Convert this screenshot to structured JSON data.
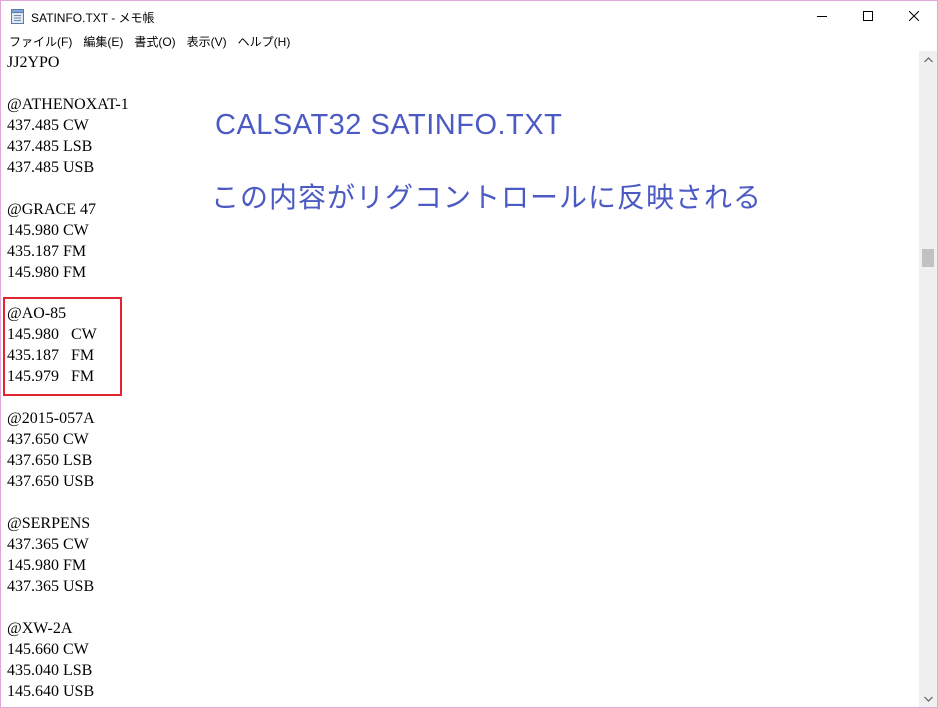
{
  "window": {
    "title": "SATINFO.TXT - メモ帳",
    "icon": "notepad-icon"
  },
  "menu": [
    {
      "label": "ファイル(F)"
    },
    {
      "label": "編集(E)"
    },
    {
      "label": "書式(O)"
    },
    {
      "label": "表示(V)"
    },
    {
      "label": "ヘルプ(H)"
    }
  ],
  "editor": {
    "lines": [
      "JJ2YPO",
      "",
      "@ATHENOXAT-1",
      "437.485 CW",
      "437.485 LSB",
      "437.485 USB",
      "",
      "@GRACE 47",
      "145.980 CW",
      "435.187 FM",
      "145.980 FM",
      "",
      "@AO-85",
      "145.980   CW",
      "435.187   FM",
      "145.979   FM",
      "",
      "@2015-057A",
      "437.650 CW",
      "437.650 LSB",
      "437.650 USB",
      "",
      "@SERPENS",
      "437.365 CW",
      "145.980 FM",
      "437.365 USB",
      "",
      "@XW-2A",
      "145.660 CW",
      "435.040 LSB",
      "145.640 USB"
    ]
  },
  "annotation": {
    "title": "CALSAT32  SATINFO.TXT",
    "subtitle": "この内容がリグコントロールに反映される",
    "color": "#4c5ac4",
    "highlight_color": "#e0252e",
    "highlighted_block": "@AO-85"
  },
  "scrollbar": {
    "position": 0.3
  }
}
